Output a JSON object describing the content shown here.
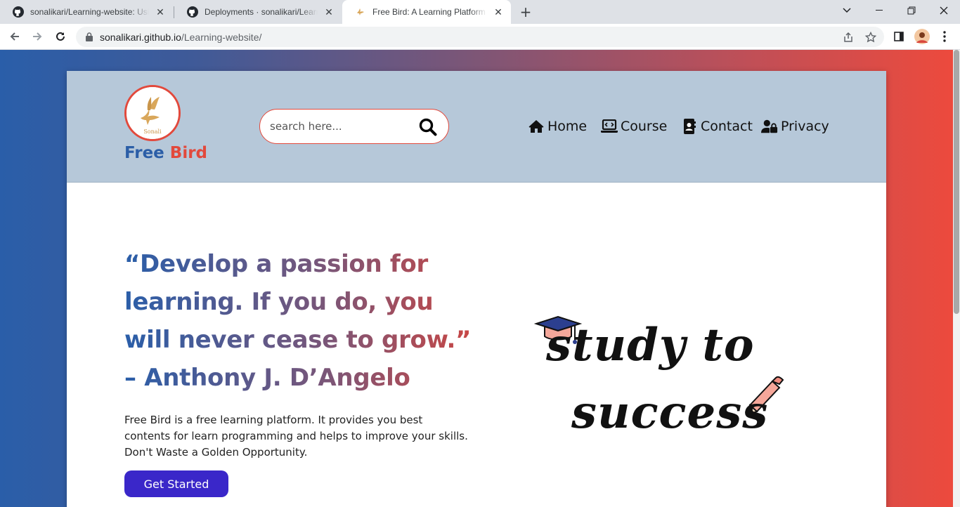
{
  "browser": {
    "tabs": [
      {
        "title": "sonalikari/Learning-website: Usin",
        "icon": "github-icon"
      },
      {
        "title": "Deployments · sonalikari/Learning",
        "icon": "github-icon"
      },
      {
        "title": "Free Bird: A Learning Platform",
        "icon": "bird-favicon",
        "active": true
      }
    ],
    "url_host": "sonalikari.github.io",
    "url_path": "/Learning-website/"
  },
  "site": {
    "logo_caption": "Sonali",
    "brand_first": "Free",
    "brand_second": "Bird",
    "search_placeholder": "search here...",
    "nav": [
      {
        "label": "Home",
        "icon": "home-icon"
      },
      {
        "label": "Course",
        "icon": "laptop-code-icon"
      },
      {
        "label": "Contact",
        "icon": "address-book-icon"
      },
      {
        "label": "Privacy",
        "icon": "user-lock-icon"
      }
    ],
    "quote_lines": [
      "“Develop a passion for",
      "learning. If you do, you",
      "will never cease to grow.”",
      "– Anthony J. D’Angelo"
    ],
    "blurb_lines": [
      "Free Bird is a free learning platform. It provides you best",
      "contents for learn programming and helps to improve your skills.",
      "Don't Waste a Golden Opportunity."
    ],
    "cta_label": "Get Started",
    "art_line1": "study to",
    "art_line2": "success"
  },
  "colors": {
    "brand_blue": "#2b5ea7",
    "brand_red": "#e2493c",
    "header_bg": "#b6c8d9",
    "cta_bg": "#3a27c9"
  }
}
